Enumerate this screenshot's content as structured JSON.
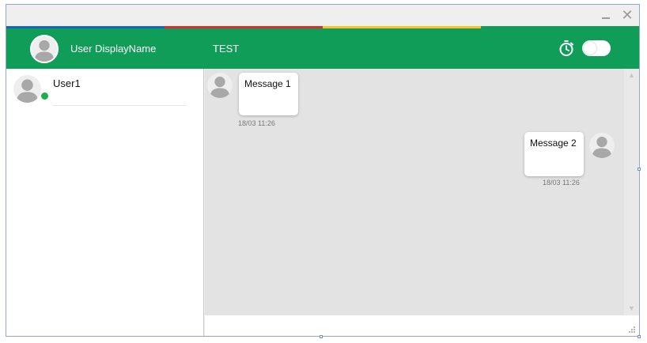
{
  "window": {
    "minimize_icon": "minimize-icon",
    "close_icon": "close-icon",
    "close_glyph": "✕",
    "stripe_colors": [
      "#1565c0",
      "#d32f2f",
      "#fbc02d",
      "#0f9d58"
    ]
  },
  "header": {
    "display_name": "User DisplayName",
    "conversation_title": "TEST",
    "timer_icon": "timer-icon",
    "toggle_on": false,
    "background": "#0f9d58"
  },
  "contacts": [
    {
      "name": "User1",
      "status": "online",
      "status_color": "#1fad4e"
    }
  ],
  "messages": [
    {
      "text": "Message 1",
      "time": "18/03 11:26",
      "direction": "incoming"
    },
    {
      "text": "Message 2",
      "time": "18/03 11:26",
      "direction": "outgoing"
    }
  ],
  "composer": {
    "value": "",
    "placeholder": ""
  }
}
